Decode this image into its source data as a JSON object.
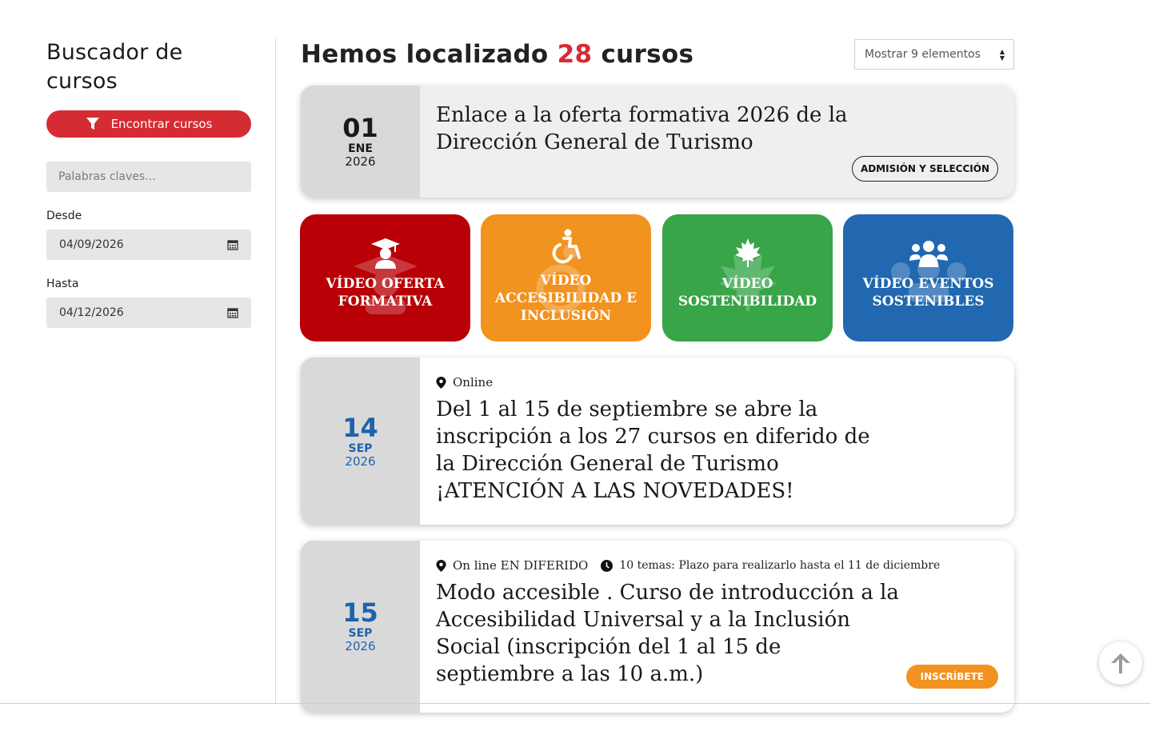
{
  "sidebar": {
    "title": "Buscador de cursos",
    "find_button": "Encontrar cursos",
    "keywords_placeholder": "Palabras claves...",
    "from_label": "Desde",
    "from_value": "04/09/2026",
    "to_label": "Hasta",
    "to_value": "04/12/2026"
  },
  "header": {
    "results_prefix": "Hemos localizado",
    "results_count": "28",
    "results_suffix": "cursos",
    "per_page": "Mostrar 9 elementos"
  },
  "cards": [
    {
      "day": "01",
      "month": "ENE",
      "year": "2026",
      "title": "Enlace a la oferta formativa 2026 de la Dirección General de Turismo",
      "tag": "ADMISIÓN Y SELECCIÓN"
    },
    {
      "day": "14",
      "month": "SEP",
      "year": "2026",
      "location": "Online",
      "title": "Del 1 al 15 de septiembre se abre la inscripción a los 27 cursos en diferido de la Dirección General de Turismo ¡ATENCIÓN A LAS NOVEDADES!"
    },
    {
      "day": "15",
      "month": "SEP",
      "year": "2026",
      "location": "On line EN DIFERIDO",
      "duration": "10 temas: Plazo para realizarlo hasta el 11 de diciembre",
      "title": "Modo accesible . Curso de introducción a la Accesibilidad Universal y a la Inclusión Social (inscripción del 1 al 15 de septiembre a las 10 a.m.)",
      "tag": "INSCRÍBETE"
    }
  ],
  "tiles": [
    {
      "label": "VÍDEO OFERTA FORMATIVA",
      "color": "#b80006",
      "icon": "graduate-icon"
    },
    {
      "label": "VÍDEO ACCESIBILIDAD E INCLUSIÓN",
      "color": "#f2921f",
      "icon": "accessibility-icon"
    },
    {
      "label": "VÍDEO SOSTENIBILIDAD",
      "color": "#37a548",
      "icon": "maple-leaf-icon"
    },
    {
      "label": "VÍDEO EVENTOS SOSTENIBLES",
      "color": "#2168b0",
      "icon": "group-icon"
    }
  ],
  "colors": {
    "accent_red": "#d52b32",
    "accent_blue": "#1d63ad",
    "orange": "#f2921f"
  }
}
